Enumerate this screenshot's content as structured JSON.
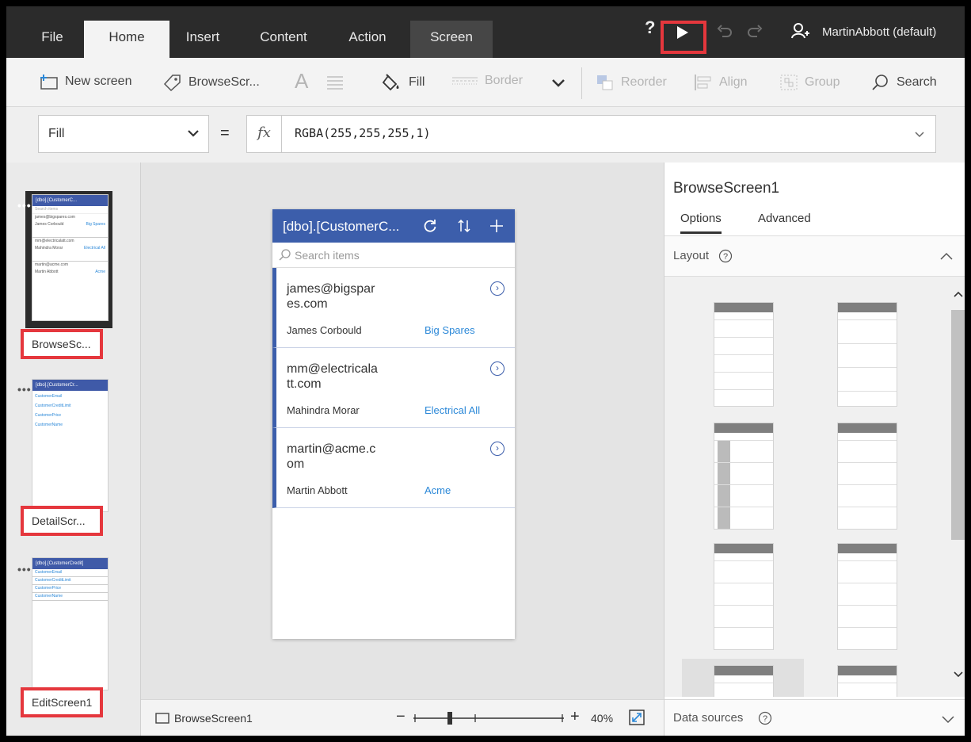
{
  "topbar": {
    "tabs": [
      "File",
      "Home",
      "Insert",
      "Content",
      "Action",
      "Screen"
    ],
    "help_label": "?",
    "user_name": "MartinAbbott (default)"
  },
  "ribbon": {
    "new_screen": "New screen",
    "screen_name": "BrowseScr...",
    "font_glyph": "A",
    "fill": "Fill",
    "border": "Border",
    "reorder": "Reorder",
    "align": "Align",
    "group": "Group",
    "search": "Search"
  },
  "formula_bar": {
    "property": "Fill",
    "equals": "=",
    "fx": "fx",
    "value": "RGBA(255,255,255,1)"
  },
  "screens": [
    {
      "label": "BrowseSc...",
      "thumb_title": "[dbo].[CustomerC..."
    },
    {
      "label": "DetailScr...",
      "thumb_title": "[dbo].[CustomerCr..."
    },
    {
      "label": "EditScreen1",
      "thumb_title": "[dbo].[CustomerCredit]"
    }
  ],
  "thumbs": {
    "browse_search": "Search items",
    "browse_rows": [
      {
        "email": "james@bigspares.com",
        "name": "James Corbould",
        "company": "Big Spares"
      },
      {
        "email": "mm@electricalatt.com",
        "name": "Mahindra Morar",
        "company": "Electrical All"
      },
      {
        "email": "martin@acme.com",
        "name": "Martin Abbott",
        "company": "Acme"
      }
    ],
    "detail_fields": [
      "CustomerEmail",
      "CustomerCreditLimit",
      "CustomerPrice",
      "CustomerName"
    ],
    "edit_fields": [
      "CustomerEmail",
      "CustomerCreditLimit",
      "CustomerPrice",
      "CustomerName"
    ]
  },
  "device": {
    "title": "[dbo].[CustomerC...",
    "search_placeholder": "Search items",
    "items": [
      {
        "email": "james@bigspar\nes.com",
        "name": "James Corbould",
        "company": "Big Spares"
      },
      {
        "email": "mm@electricala\ntt.com",
        "name": "Mahindra Morar",
        "company": "Electrical All"
      },
      {
        "email": "martin@acme.c\nom",
        "name": "Martin Abbott",
        "company": "Acme"
      }
    ]
  },
  "statusbar": {
    "screen_name": "BrowseScreen1",
    "zoom": "40%",
    "minus": "−",
    "plus": "+"
  },
  "right_panel": {
    "screen_name": "BrowseScreen1",
    "tabs": [
      "Options",
      "Advanced"
    ],
    "layout_label": "Layout",
    "data_sources_label": "Data sources"
  },
  "colors": {
    "accent_blue": "#3c5eab",
    "link_blue": "#2b88d8",
    "highlight_red": "#e5373d",
    "topbar": "#2b2b2b"
  }
}
